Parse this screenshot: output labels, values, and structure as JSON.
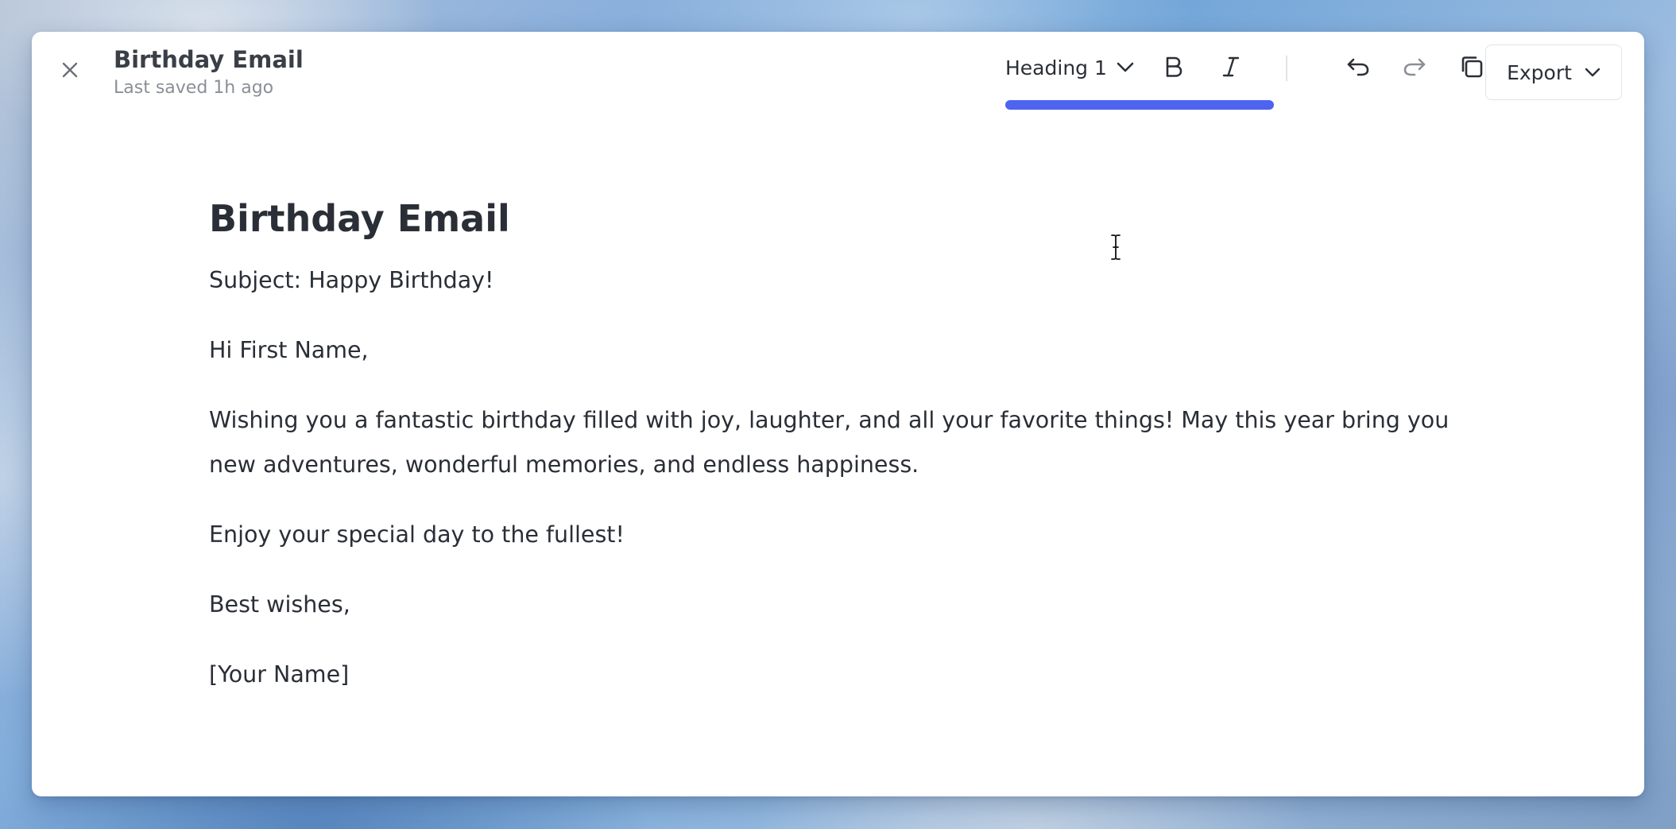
{
  "header": {
    "title": "Birthday Email",
    "saved_status": "Last saved 1h ago"
  },
  "toolbar": {
    "block_style": "Heading 1",
    "bold_label": "B",
    "italic_label": "I",
    "export_label": "Export",
    "accent_color": "#4e63ef"
  },
  "document": {
    "title": "Birthday Email",
    "paragraphs": [
      "Subject: Happy Birthday!",
      "Hi First Name,",
      "Wishing you a fantastic birthday filled with joy, laughter, and all your favorite things! May this year bring you new adventures, wonderful memories, and endless happiness.",
      "Enjoy your special day to the fullest!",
      "Best wishes,",
      "[Your Name]"
    ]
  },
  "icons": {
    "close": "close-icon",
    "dropdown": "chevron-down-icon",
    "undo": "undo-icon",
    "redo": "redo-icon",
    "copy": "copy-icon",
    "cursor": "text-cursor-icon"
  }
}
